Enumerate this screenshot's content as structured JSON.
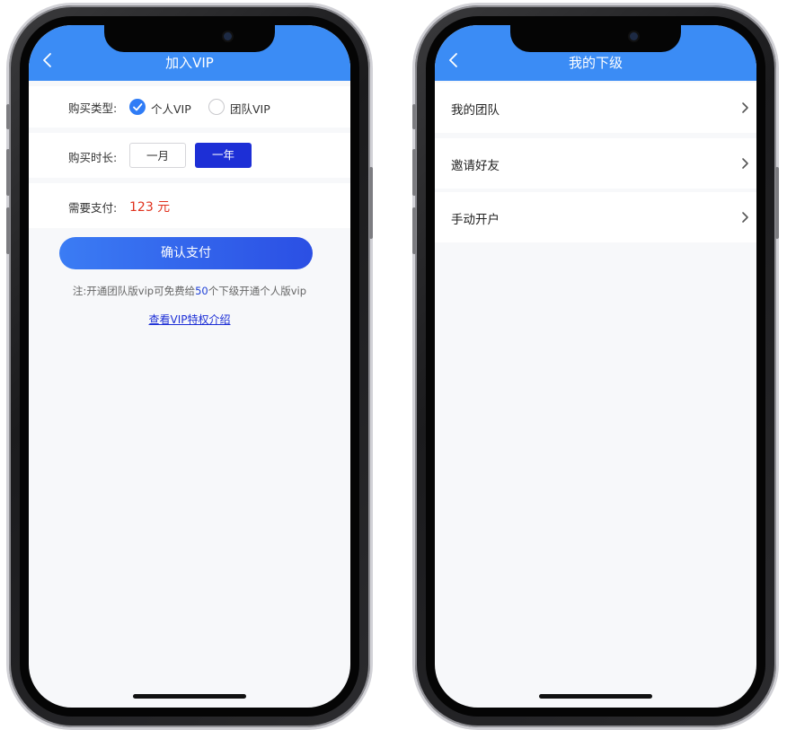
{
  "left_screen": {
    "nav_title": "加入VIP",
    "purchase_type": {
      "label": "购买类型:",
      "options": [
        {
          "label": "个人VIP",
          "checked": true
        },
        {
          "label": "团队VIP",
          "checked": false
        }
      ]
    },
    "duration": {
      "label": "购买时长:",
      "options": [
        {
          "label": "一月",
          "selected": false
        },
        {
          "label": "一年",
          "selected": true
        }
      ]
    },
    "payment": {
      "label": "需要支付:",
      "amount": "123 元"
    },
    "confirm_label": "确认支付",
    "note": {
      "prefix": "注:开通团队版vip可免费给",
      "count": "50",
      "suffix": "个下级开通个人版vip"
    },
    "privilege_link": "查看VIP特权介绍"
  },
  "right_screen": {
    "nav_title": "我的下级",
    "items": [
      {
        "label": "我的团队"
      },
      {
        "label": "邀请好友"
      },
      {
        "label": "手动开户"
      }
    ]
  },
  "colors": {
    "nav_blue": "#3b8cf5",
    "primary_dark_blue": "#1d2fd6",
    "price_red": "#e0311d",
    "page_bg": "#f7f8fa"
  },
  "icons": [
    "back-arrow-icon",
    "check-icon",
    "chevron-right-icon"
  ]
}
